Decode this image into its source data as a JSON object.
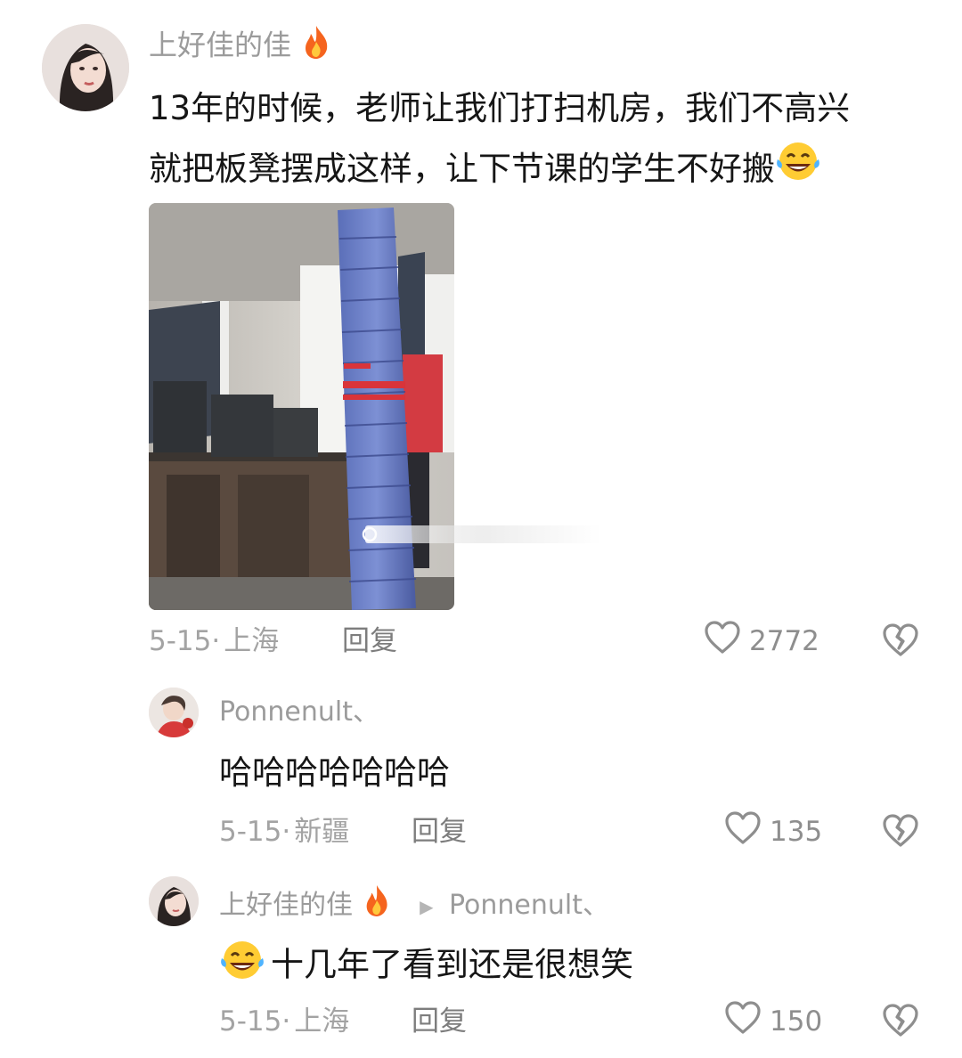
{
  "comments": [
    {
      "username": "上好佳的佳",
      "text_line1": "13年的时候，老师让我们打扫机房，我们不高兴",
      "text_line2": "就把板凳摆成这样，让下节课的学生不好搬",
      "emoji": "laughing-crying",
      "date": "5-15",
      "location": "上海",
      "reply_label": "回复",
      "likes": "2772"
    },
    {
      "username": "Ponnenult、",
      "text": "哈哈哈哈哈哈哈",
      "date": "5-15",
      "location": "新疆",
      "reply_label": "回复",
      "likes": "135"
    },
    {
      "username": "上好佳的佳",
      "reply_to": "Ponnenult、",
      "text": "十几年了看到还是很想笑",
      "emoji": "laughing-crying",
      "date": "5-15",
      "location": "上海",
      "reply_label": "回复",
      "likes": "150"
    }
  ],
  "separator": "·",
  "icons": [
    "fire-icon",
    "heart-icon",
    "broken-heart-icon",
    "laughing-crying-emoji",
    "play-triangle-icon"
  ],
  "colors": {
    "meta_gray": "#a3a3a3",
    "fire_orange": "#f5641e",
    "text": "#161616"
  }
}
